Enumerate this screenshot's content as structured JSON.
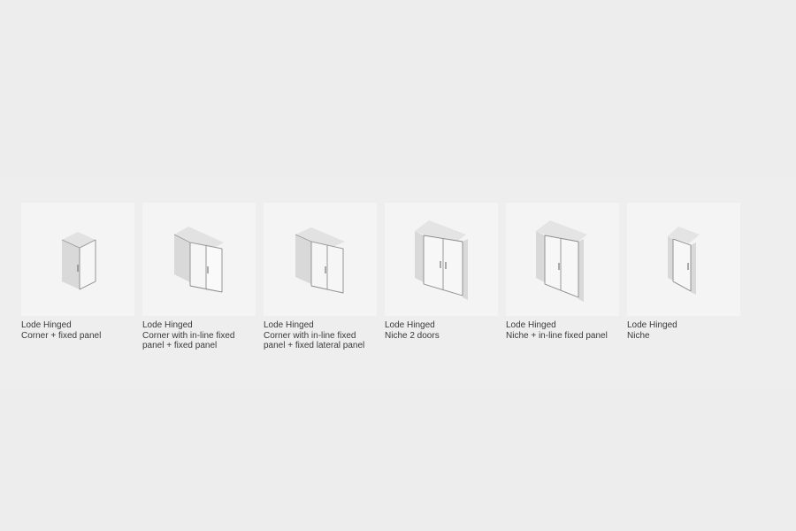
{
  "products": [
    {
      "title": "Lode Hinged",
      "subtitle": "Corner + fixed panel",
      "icon": "shower-corner-fixed-panel-icon"
    },
    {
      "title": "Lode Hinged",
      "subtitle": "Corner with in-line fixed panel + fixed panel",
      "icon": "shower-corner-inline-fixed-icon"
    },
    {
      "title": "Lode Hinged",
      "subtitle": "Corner with in-line fixed panel + fixed lateral panel",
      "icon": "shower-corner-inline-lateral-icon"
    },
    {
      "title": "Lode Hinged",
      "subtitle": "Niche 2 doors",
      "icon": "shower-niche-2-doors-icon"
    },
    {
      "title": "Lode Hinged",
      "subtitle": "Niche + in-line fixed panel",
      "icon": "shower-niche-inline-fixed-icon"
    },
    {
      "title": "Lode Hinged",
      "subtitle": "Niche",
      "icon": "shower-niche-icon"
    }
  ]
}
